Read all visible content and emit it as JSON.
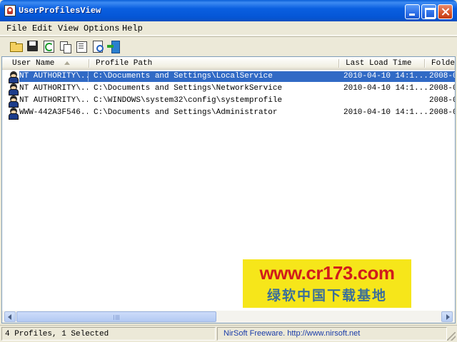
{
  "window": {
    "title": "UserProfilesView"
  },
  "menu": [
    {
      "label": "File"
    },
    {
      "label": "Edit"
    },
    {
      "label": "View"
    },
    {
      "label": "Options"
    },
    {
      "label": "Help"
    }
  ],
  "toolbar": {
    "icons": [
      "open-folder-icon",
      "save-icon",
      "refresh-icon",
      "copy-icon",
      "properties-icon",
      "find-icon",
      "exit-icon"
    ]
  },
  "columns": [
    {
      "label": "User Name"
    },
    {
      "label": "Profile Path"
    },
    {
      "label": "Last Load Time"
    },
    {
      "label": "Folde"
    }
  ],
  "rows": [
    {
      "user": "NT AUTHORITY\\...",
      "path": "C:\\Documents and Settings\\LocalService",
      "last_load": "2010-04-10 14:1...",
      "folder": "2008-0",
      "selected": true
    },
    {
      "user": "NT AUTHORITY\\...",
      "path": "C:\\Documents and Settings\\NetworkService",
      "last_load": "2010-04-10 14:1...",
      "folder": "2008-0",
      "selected": false
    },
    {
      "user": "NT AUTHORITY\\...",
      "path": "C:\\WINDOWS\\system32\\config\\systemprofile",
      "last_load": "",
      "folder": "2008-0",
      "selected": false
    },
    {
      "user": "WWW-442A3F546...",
      "path": "C:\\Documents and Settings\\Administrator",
      "last_load": "2010-04-10 14:1...",
      "folder": "2008-0",
      "selected": false
    }
  ],
  "watermark": {
    "url": "www.cr173.com",
    "text": "绿软中国下载基地"
  },
  "status": {
    "summary": "4 Profiles, 1 Selected",
    "credit": "NirSoft Freeware.  http://www.nirsoft.net"
  },
  "colors": {
    "selection": "#316ac5",
    "titlebar": "#0a5fd8",
    "watermark_bg": "#f6e61a",
    "watermark_url": "#d01c1c"
  }
}
